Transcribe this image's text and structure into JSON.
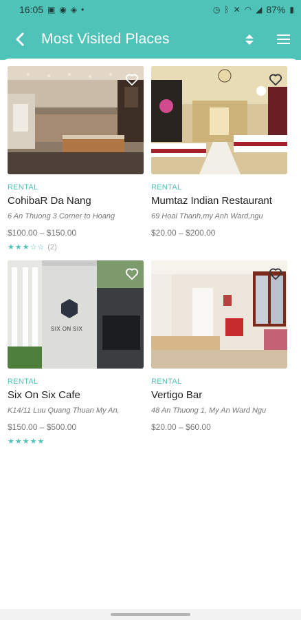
{
  "status": {
    "time": "16:05",
    "battery": "87%"
  },
  "header": {
    "title": "Most Visited Places"
  },
  "places": [
    {
      "tag": "RENTAL",
      "name": "CohibaR Da Nang",
      "address": "6 An Thuong 3 Corner to Hoang",
      "price": "$100.00 – $150.00",
      "stars": "★★★☆☆",
      "reviews": "(2)"
    },
    {
      "tag": "RENTAL",
      "name": "Mumtaz Indian Restaurant",
      "address": "69 Hoai Thanh,my Anh Ward,ngu",
      "price": "$20.00 – $200.00"
    },
    {
      "tag": "RENTAL",
      "name": "Six On Six Cafe",
      "address": "K14/11 Luu Quang Thuan My An,",
      "price": "$150.00 – $500.00",
      "stars": "★★★★★",
      "sign": "SIX ON SIX"
    },
    {
      "tag": "RENTAL",
      "name": "Vertigo Bar",
      "address": "48 An Thuong 1, My An Ward Ngu",
      "price": "$20.00 – $60.00"
    }
  ]
}
